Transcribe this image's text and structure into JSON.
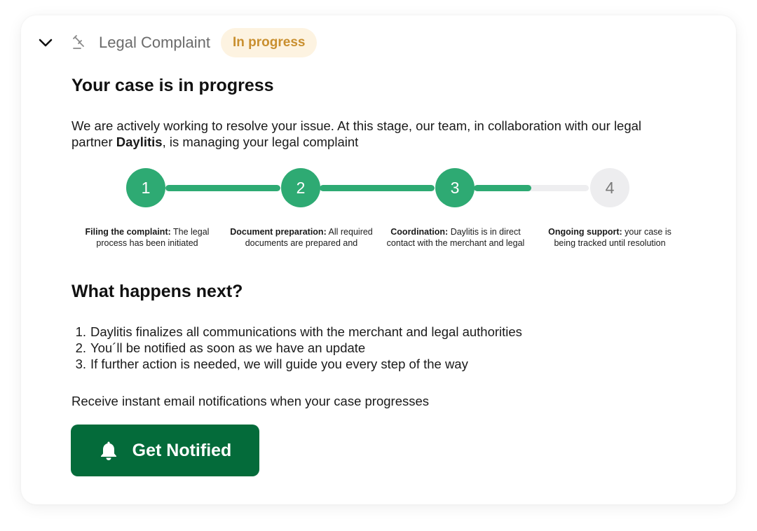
{
  "header": {
    "title": "Legal Complaint",
    "status": "In progress",
    "icons": {
      "collapse": "chevron-down-icon",
      "category": "gavel-icon"
    }
  },
  "main": {
    "heading": "Your case is in progress",
    "intro_before": "We are actively working to resolve your issue. At this stage, our team, in collaboration with our legal partner ",
    "intro_partner": "Daylitis",
    "intro_after": ", is managing your legal complaint"
  },
  "steps": [
    {
      "number": "1",
      "status": "complete",
      "title": "Filing the complaint:",
      "line1_rest": "The legal",
      "line2": "process has been initiated"
    },
    {
      "number": "2",
      "status": "complete",
      "title": "Document preparation:",
      "line1_rest": "All required",
      "line2": "documents are prepared and"
    },
    {
      "number": "3",
      "status": "current",
      "title": "Coordination:",
      "line1_rest": "Daylitis is in direct",
      "line2": "contact with the merchant and legal"
    },
    {
      "number": "4",
      "status": "pending",
      "title": "Ongoing support:",
      "line1_rest": "your case is",
      "line2": "being tracked until resolution"
    }
  ],
  "progress": {
    "connector_fill": [
      1.0,
      1.0,
      0.5
    ]
  },
  "next": {
    "heading": "What happens next?",
    "items": [
      {
        "num": "1.",
        "text": "Daylitis finalizes all communications with the merchant and legal authorities"
      },
      {
        "num": "2.",
        "text": "You´ll be notified as soon as we have an update"
      },
      {
        "num": "3.",
        "text": "If further action is needed, we will guide you every step of the way"
      }
    ]
  },
  "notify": {
    "text": "Receive instant email notifications when your case progresses",
    "button_label": "Get Notified",
    "button_icon": "bell-icon"
  },
  "colors": {
    "accent_green": "#2eaa73",
    "button_green": "#046b3a",
    "badge_bg": "#fdf3e1",
    "badge_text": "#c98f2f",
    "pending_gray": "#ededef"
  }
}
